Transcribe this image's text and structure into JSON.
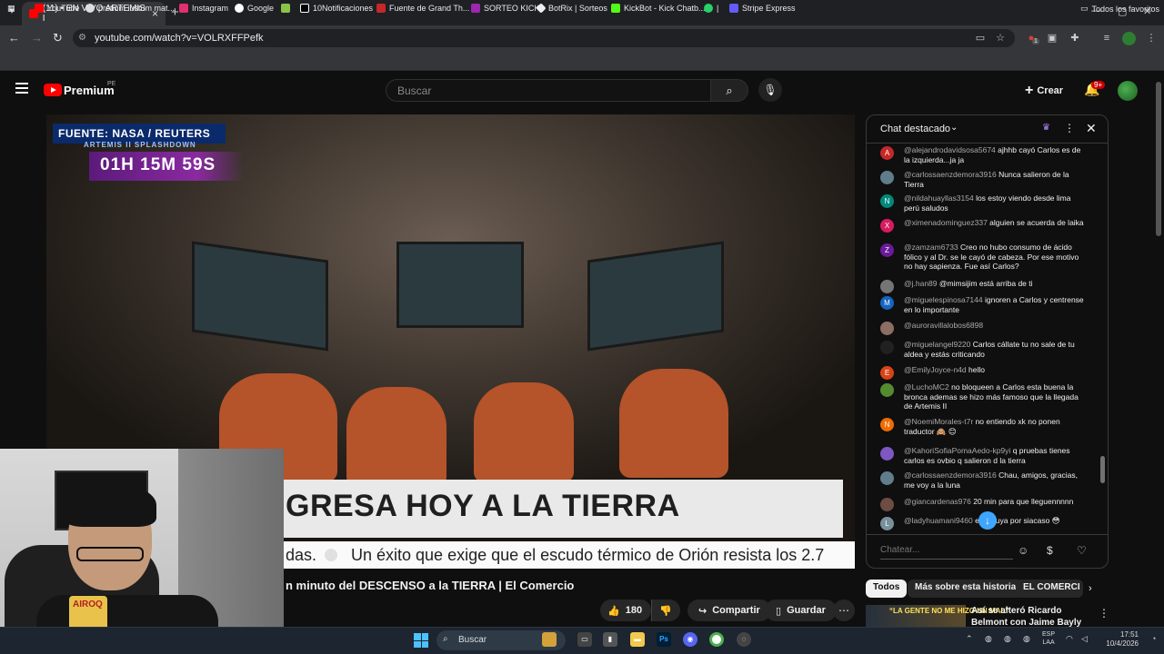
{
  "browser": {
    "tab_title": "(11) • EN VIVO ARTEMIS I",
    "url": "youtube.com/watch?v=VOLRXFFPefk",
    "bookmarks": [
      "YouTube",
      "pretium iustum mat...",
      "Instagram",
      "Google",
      "10Notificaciones",
      "Fuente de Grand Th...",
      "SORTEO KICK",
      "BotRix | Sorteos",
      "KickBot - Kick Chatb...",
      "|",
      "Stripe Express"
    ],
    "all_bookmarks": "Todos los favoritos",
    "profile_badge": "1"
  },
  "youtube": {
    "brand": "Premium",
    "country": "PE",
    "search_placeholder": "Buscar",
    "create_label": "Crear",
    "notif_count": "9+"
  },
  "video": {
    "source_badge": "FUENTE: NASA / REUTERS",
    "source_sub": "ARTEMIS II SPLASHDOWN",
    "timer": "01H 15M 59S",
    "headline": "GRESA HOY A LA TIERRA",
    "ticker_prefix": "das.",
    "ticker_text": "Un éxito que exige que el escudo térmico de Orión resista los 2.7",
    "drink_label": "AIROQ",
    "title": "n minuto del DESCENSO a la TIERRA | El Comercio",
    "likes": "180",
    "share_label": "Compartir",
    "save_label": "Guardar"
  },
  "chat": {
    "title": "Chat destacado",
    "input_placeholder": "Chatear...",
    "messages": [
      {
        "author": "@alejandrodavidsosa5674",
        "text": "ajhhb cayó Carlos es de la izquierda...ja ja",
        "initial": "A",
        "color": "#c62828"
      },
      {
        "author": "@carlossaenzdemora3916",
        "text": "Nunca salieron de la Tierra",
        "initial": "",
        "color": "#607d8b"
      },
      {
        "author": "@nildahuayllas3154",
        "text": "los estoy viendo desde lima perú saludos",
        "initial": "N",
        "color": "#00897b"
      },
      {
        "author": "@ximenadominguez337",
        "text": "alguien se acuerda de laika",
        "initial": "X",
        "color": "#d81b60"
      },
      {
        "author": "@zamzam6733",
        "text": "Creo no hubo consumo de ácido fólico y al Dr. se le cayó de cabeza. Por ese motivo no hay sapienza. Fue así Carlos?",
        "initial": "Z",
        "color": "#6a1b9a"
      },
      {
        "author": "@j.han89",
        "text": "@mimsijim está arriba de ti",
        "initial": "",
        "color": "#757575"
      },
      {
        "author": "@miguelespinosa7144",
        "text": "ignoren a Carlos y centrense en lo importante",
        "initial": "M",
        "color": "#1565c0"
      },
      {
        "author": "@auroravillalobos6898",
        "text": "",
        "initial": "",
        "color": "#8d6e63"
      },
      {
        "author": "@miguelangel9220",
        "text": "Carlos cállate tu no sale de tu aldea y estás criticando",
        "initial": "",
        "color": "#212121"
      },
      {
        "author": "@EmilyJoyce-n4d",
        "text": "hello",
        "initial": "E",
        "color": "#d84315"
      },
      {
        "author": "@LuchoMC2",
        "text": "no bloqueen a Carlos esta buena la bronca ademas se hizo más famoso que la llegada de Artemis II",
        "initial": "",
        "color": "#558b2f"
      },
      {
        "author": "@NoemiMorales-t7r",
        "text": "no entiendo xk no ponen traductor 🙈 😊",
        "initial": "N",
        "color": "#ef6c00"
      },
      {
        "author": "@KahoriSofiaPomaAedo-kp9yi",
        "text": "q pruebas tienes carlos es ovbio q salieron d la tierra",
        "initial": "",
        "color": "#7e57c2"
      },
      {
        "author": "@carlossaenzdemora3916",
        "text": "Chau, amigos, gracias, me voy a la luna",
        "initial": "",
        "color": "#607d8b"
      },
      {
        "author": "@giancardenas976",
        "text": "20 min para que lleguennnnn",
        "initial": "",
        "color": "#6d4c41"
      },
      {
        "author": "@ladyhuamani9460",
        "text": "es la tuya por siacaso 😳",
        "initial": "L",
        "color": "#78909c"
      }
    ]
  },
  "chips": [
    "Todos",
    "Más sobre esta historia",
    "EL COMERCI"
  ],
  "recommendation": {
    "thumb_text": "“LA GENTE NO ME HIZO UN MAL”",
    "title": "Así se alteró Ricardo Belmont con Jaime Bayly sobre ..."
  },
  "taskbar": {
    "search": "Buscar",
    "lang_top": "ESP",
    "lang_bottom": "LAA",
    "time": "17:51",
    "date": "10/4/2026"
  }
}
